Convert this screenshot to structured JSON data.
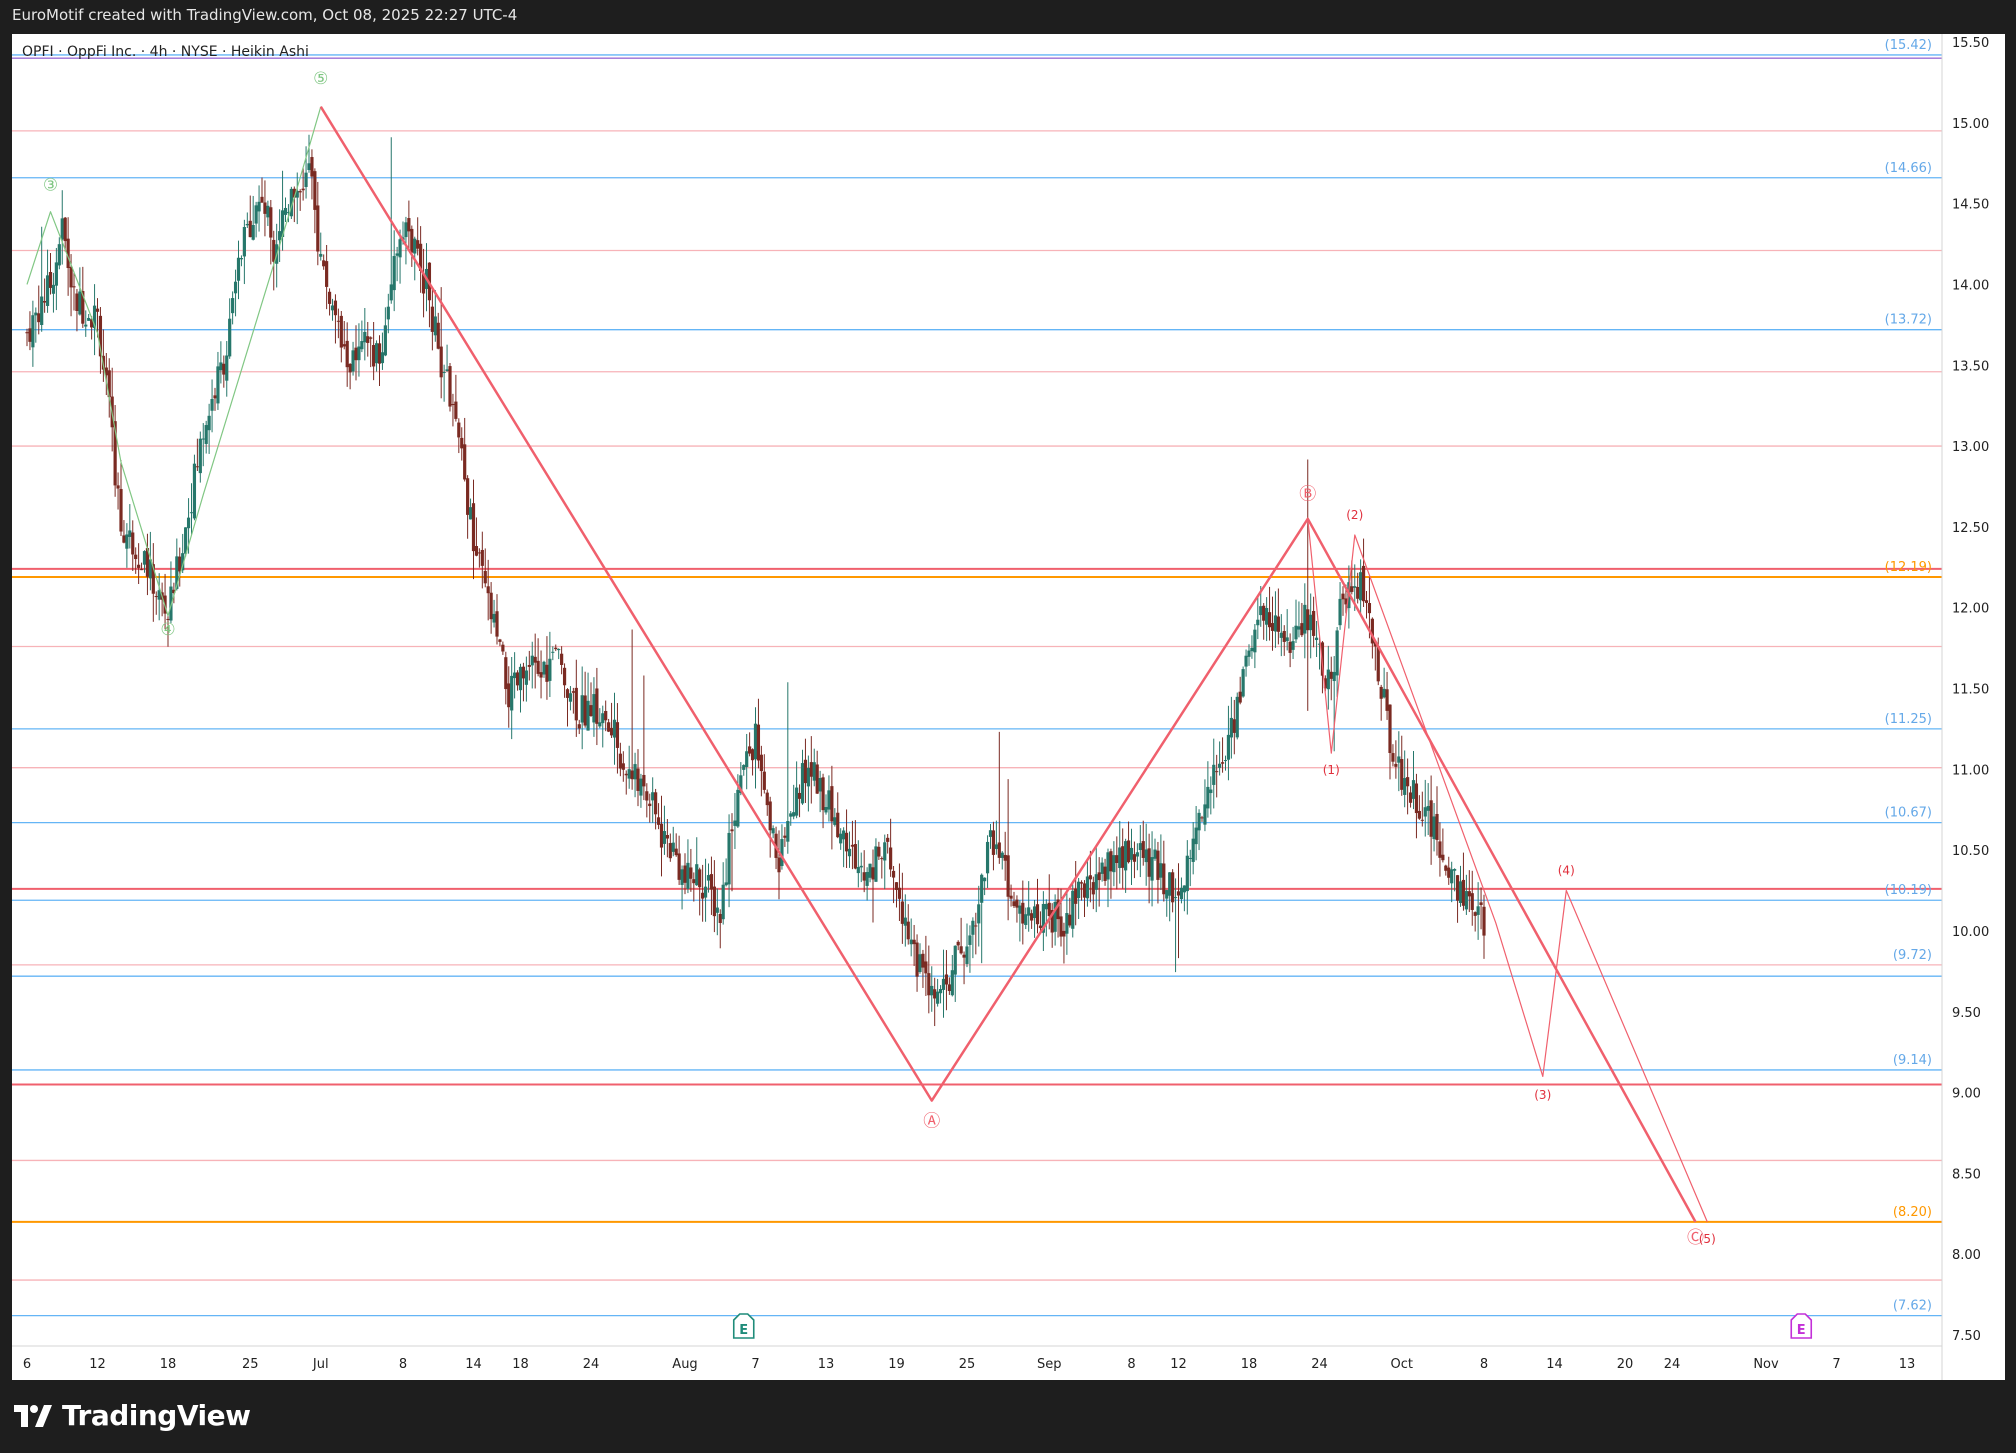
{
  "header": {
    "caption": "EuroMotif created with TradingView.com, Oct 08, 2025 22:27 UTC-4"
  },
  "legend": {
    "symbol_line": "OPFI · OppFi Inc. · 4h · NYSE · Heikin Ashi"
  },
  "brand": {
    "name": "TradingView",
    "icon": "tradingview-logo-icon"
  },
  "colors": {
    "bull": "#26776b",
    "bear": "#7a2a22",
    "wave_red": "#f0606d",
    "wave_green": "#81c784",
    "level_blue": "#64b5f6",
    "level_pink": "#f7b3b8",
    "level_orange": "#ff9800",
    "label_blue": "#64a8e8",
    "label_orange": "#ff9800",
    "earnings": "#1f8c7a",
    "earnings_future": "#c330d8"
  },
  "chart_data": {
    "type": "candlestick",
    "title": "OPFI · OppFi Inc. · 4h · NYSE · Heikin Ashi",
    "y_axis": {
      "min": 7.5,
      "max": 15.5,
      "ticks": [
        "15.50",
        "15.00",
        "14.50",
        "14.00",
        "13.50",
        "13.00",
        "12.50",
        "12.00",
        "11.50",
        "11.00",
        "10.50",
        "10.00",
        "9.50",
        "9.00",
        "8.50",
        "8.00",
        "7.50"
      ]
    },
    "x_axis": {
      "start": "2025-06-06",
      "end": "2025-11-13",
      "ticks": [
        {
          "date": "2025-06-06",
          "label": "6"
        },
        {
          "date": "2025-06-12",
          "label": "12"
        },
        {
          "date": "2025-06-18",
          "label": "18"
        },
        {
          "date": "2025-06-25",
          "label": "25"
        },
        {
          "date": "2025-07-01",
          "label": "Jul"
        },
        {
          "date": "2025-07-08",
          "label": "8"
        },
        {
          "date": "2025-07-14",
          "label": "14"
        },
        {
          "date": "2025-07-18",
          "label": "18"
        },
        {
          "date": "2025-07-24",
          "label": "24"
        },
        {
          "date": "2025-08-01",
          "label": "Aug"
        },
        {
          "date": "2025-08-07",
          "label": "7"
        },
        {
          "date": "2025-08-13",
          "label": "13"
        },
        {
          "date": "2025-08-19",
          "label": "19"
        },
        {
          "date": "2025-08-25",
          "label": "25"
        },
        {
          "date": "2025-09-01",
          "label": "Sep"
        },
        {
          "date": "2025-09-08",
          "label": "8"
        },
        {
          "date": "2025-09-12",
          "label": "12"
        },
        {
          "date": "2025-09-18",
          "label": "18"
        },
        {
          "date": "2025-09-24",
          "label": "24"
        },
        {
          "date": "2025-10-01",
          "label": "Oct"
        },
        {
          "date": "2025-10-08",
          "label": "8"
        },
        {
          "date": "2025-10-14",
          "label": "14"
        },
        {
          "date": "2025-10-20",
          "label": "20"
        },
        {
          "date": "2025-10-24",
          "label": "24"
        },
        {
          "date": "2025-11-01",
          "label": "Nov"
        },
        {
          "date": "2025-11-07",
          "label": "7"
        },
        {
          "date": "2025-11-13",
          "label": "13"
        }
      ]
    },
    "price_path": [
      [
        "2025-06-06",
        13.7
      ],
      [
        "2025-06-08",
        14.0
      ],
      [
        "2025-06-09",
        14.35
      ],
      [
        "2025-06-10",
        13.9
      ],
      [
        "2025-06-12",
        13.8
      ],
      [
        "2025-06-13",
        13.2
      ],
      [
        "2025-06-14",
        12.5
      ],
      [
        "2025-06-16",
        12.3
      ],
      [
        "2025-06-17",
        12.1
      ],
      [
        "2025-06-18",
        11.95
      ],
      [
        "2025-06-19",
        12.3
      ],
      [
        "2025-06-20",
        12.7
      ],
      [
        "2025-06-21",
        13.1
      ],
      [
        "2025-06-23",
        13.6
      ],
      [
        "2025-06-24",
        14.1
      ],
      [
        "2025-06-25",
        14.4
      ],
      [
        "2025-06-26",
        14.55
      ],
      [
        "2025-06-27",
        14.25
      ],
      [
        "2025-06-28",
        14.5
      ],
      [
        "2025-06-30",
        14.7
      ],
      [
        "2025-07-01",
        14.15
      ],
      [
        "2025-07-02",
        13.85
      ],
      [
        "2025-07-03",
        13.55
      ],
      [
        "2025-07-04",
        13.5
      ],
      [
        "2025-07-05",
        13.65
      ],
      [
        "2025-07-06",
        13.5
      ],
      [
        "2025-07-07",
        14.05
      ],
      [
        "2025-07-08",
        14.4
      ],
      [
        "2025-07-09",
        14.2
      ],
      [
        "2025-07-10",
        14.0
      ],
      [
        "2025-07-11",
        13.6
      ],
      [
        "2025-07-12",
        13.3
      ],
      [
        "2025-07-13",
        12.9
      ],
      [
        "2025-07-14",
        12.4
      ],
      [
        "2025-07-15",
        12.1
      ],
      [
        "2025-07-16",
        11.8
      ],
      [
        "2025-07-17",
        11.45
      ],
      [
        "2025-07-18",
        11.55
      ],
      [
        "2025-07-19",
        11.6
      ],
      [
        "2025-07-20",
        11.6
      ],
      [
        "2025-07-21",
        11.7
      ],
      [
        "2025-07-22",
        11.55
      ],
      [
        "2025-07-23",
        11.35
      ],
      [
        "2025-07-24",
        11.4
      ],
      [
        "2025-07-25",
        11.3
      ],
      [
        "2025-07-26",
        11.2
      ],
      [
        "2025-07-27",
        11.0
      ],
      [
        "2025-07-28",
        10.9
      ],
      [
        "2025-07-29",
        10.8
      ],
      [
        "2025-07-30",
        10.6
      ],
      [
        "2025-07-31",
        10.5
      ],
      [
        "2025-08-01",
        10.3
      ],
      [
        "2025-08-02",
        10.35
      ],
      [
        "2025-08-03",
        10.25
      ],
      [
        "2025-08-04",
        10.1
      ],
      [
        "2025-08-05",
        10.7
      ],
      [
        "2025-08-06",
        11.0
      ],
      [
        "2025-08-07",
        11.2
      ],
      [
        "2025-08-08",
        10.7
      ],
      [
        "2025-08-09",
        10.45
      ],
      [
        "2025-08-10",
        10.7
      ],
      [
        "2025-08-11",
        10.95
      ],
      [
        "2025-08-12",
        11.0
      ],
      [
        "2025-08-13",
        10.8
      ],
      [
        "2025-08-14",
        10.65
      ],
      [
        "2025-08-15",
        10.5
      ],
      [
        "2025-08-16",
        10.35
      ],
      [
        "2025-08-17",
        10.4
      ],
      [
        "2025-08-18",
        10.5
      ],
      [
        "2025-08-19",
        10.3
      ],
      [
        "2025-08-20",
        10.0
      ],
      [
        "2025-08-21",
        9.75
      ],
      [
        "2025-08-22",
        9.6
      ],
      [
        "2025-08-23",
        9.6
      ],
      [
        "2025-08-24",
        9.8
      ],
      [
        "2025-08-25",
        9.9
      ],
      [
        "2025-08-26",
        10.2
      ],
      [
        "2025-08-27",
        10.6
      ],
      [
        "2025-08-28",
        10.4
      ],
      [
        "2025-08-29",
        10.1
      ],
      [
        "2025-08-30",
        10.15
      ],
      [
        "2025-08-31",
        10.05
      ],
      [
        "2025-09-01",
        10.1
      ],
      [
        "2025-09-02",
        10.05
      ],
      [
        "2025-09-03",
        10.15
      ],
      [
        "2025-09-04",
        10.25
      ],
      [
        "2025-09-05",
        10.35
      ],
      [
        "2025-09-06",
        10.4
      ],
      [
        "2025-09-07",
        10.45
      ],
      [
        "2025-09-08",
        10.5
      ],
      [
        "2025-09-09",
        10.45
      ],
      [
        "2025-09-10",
        10.4
      ],
      [
        "2025-09-11",
        10.3
      ],
      [
        "2025-09-12",
        10.25
      ],
      [
        "2025-09-13",
        10.45
      ],
      [
        "2025-09-14",
        10.8
      ],
      [
        "2025-09-15",
        10.95
      ],
      [
        "2025-09-16",
        11.1
      ],
      [
        "2025-09-17",
        11.4
      ],
      [
        "2025-09-18",
        11.75
      ],
      [
        "2025-09-19",
        11.95
      ],
      [
        "2025-09-20",
        11.95
      ],
      [
        "2025-09-21",
        11.75
      ],
      [
        "2025-09-22",
        11.8
      ],
      [
        "2025-09-23",
        11.95
      ],
      [
        "2025-09-24",
        11.7
      ],
      [
        "2025-09-25",
        11.5
      ],
      [
        "2025-09-26",
        12.1
      ],
      [
        "2025-09-27",
        12.2
      ],
      [
        "2025-09-28",
        12.05
      ],
      [
        "2025-09-29",
        11.6
      ],
      [
        "2025-09-30",
        11.2
      ],
      [
        "2025-10-01",
        10.95
      ],
      [
        "2025-10-02",
        10.85
      ],
      [
        "2025-10-03",
        10.75
      ],
      [
        "2025-10-04",
        10.55
      ],
      [
        "2025-10-05",
        10.4
      ],
      [
        "2025-10-06",
        10.25
      ],
      [
        "2025-10-07",
        10.1
      ],
      [
        "2025-10-08",
        10.05
      ]
    ],
    "levels": [
      {
        "value": 15.42,
        "color": "#64b5f6",
        "label": "(15.42)",
        "label_color": "#64a8e8"
      },
      {
        "value": 15.4,
        "color": "#9c6fd6"
      },
      {
        "value": 14.95,
        "color": "#f7b3b8"
      },
      {
        "value": 14.66,
        "color": "#64b5f6",
        "label": "(14.66)",
        "label_color": "#64a8e8"
      },
      {
        "value": 14.21,
        "color": "#f7b3b8"
      },
      {
        "value": 13.72,
        "color": "#64b5f6",
        "label": "(13.72)",
        "label_color": "#64a8e8"
      },
      {
        "value": 13.46,
        "color": "#f7b3b8"
      },
      {
        "value": 13.0,
        "color": "#f7b3b8"
      },
      {
        "value": 12.24,
        "color": "#f0606d"
      },
      {
        "value": 12.19,
        "color": "#ff9800",
        "label": "(12.19)",
        "label_color": "#ff9800"
      },
      {
        "value": 11.76,
        "color": "#f7b3b8"
      },
      {
        "value": 11.25,
        "color": "#64b5f6",
        "label": "(11.25)",
        "label_color": "#64a8e8"
      },
      {
        "value": 11.01,
        "color": "#f7b3b8"
      },
      {
        "value": 10.67,
        "color": "#64b5f6",
        "label": "(10.67)",
        "label_color": "#64a8e8"
      },
      {
        "value": 10.26,
        "color": "#f0606d"
      },
      {
        "value": 10.19,
        "color": "#64b5f6",
        "label": "(10.19)",
        "label_color": "#64a8e8"
      },
      {
        "value": 9.79,
        "color": "#f7b3b8",
        "label": "(9.72)",
        "label_color": "#64a8e8"
      },
      {
        "value": 9.72,
        "color": "#64b5f6"
      },
      {
        "value": 9.14,
        "color": "#64b5f6",
        "label": "(9.14)",
        "label_color": "#64a8e8"
      },
      {
        "value": 9.05,
        "color": "#f0606d"
      },
      {
        "value": 8.58,
        "color": "#f7b3b8"
      },
      {
        "value": 8.2,
        "color": "#ff9800",
        "label": "(8.20)",
        "label_color": "#ff9800"
      },
      {
        "value": 7.84,
        "color": "#f7b3b8"
      },
      {
        "value": 7.62,
        "color": "#64b5f6",
        "label": "(7.62)",
        "label_color": "#64a8e8"
      }
    ],
    "waves": [
      {
        "name": "green-impulse",
        "color": "#81c784",
        "width": 1.2,
        "points": [
          [
            "2025-06-06",
            14.0
          ],
          [
            "2025-06-08",
            14.45
          ],
          [
            "2025-06-12",
            13.7
          ],
          [
            "2025-06-14",
            12.9
          ],
          [
            "2025-06-18",
            11.95
          ],
          [
            "2025-06-21",
            12.7
          ],
          [
            "2025-06-29",
            14.6
          ],
          [
            "2025-07-01",
            15.1
          ]
        ]
      },
      {
        "name": "abc-correction",
        "color": "#f0606d",
        "width": 2.5,
        "points": [
          [
            "2025-07-01",
            15.1
          ],
          [
            "2025-08-22",
            8.95
          ],
          [
            "2025-09-23",
            12.55
          ],
          [
            "2025-10-26",
            8.2
          ]
        ]
      },
      {
        "name": "impulse-5",
        "color": "#f0606d",
        "width": 1.2,
        "points": [
          [
            "2025-09-23",
            12.55
          ],
          [
            "2025-09-25",
            11.1
          ],
          [
            "2025-09-27",
            12.45
          ],
          [
            "2025-10-09",
            10.05
          ],
          [
            "2025-10-13",
            9.1
          ],
          [
            "2025-10-15",
            10.25
          ],
          [
            "2025-10-27",
            8.2
          ]
        ]
      }
    ],
    "wave_labels": [
      {
        "text": "③",
        "date": "2025-06-08",
        "value": 14.58,
        "color": "#81c784"
      },
      {
        "text": "④",
        "date": "2025-06-18",
        "value": 11.83,
        "color": "#81c784"
      },
      {
        "text": "⑤",
        "date": "2025-07-01",
        "value": 15.24,
        "color": "#81c784"
      },
      {
        "text": "Ⓐ",
        "date": "2025-08-22",
        "value": 8.79,
        "color": "#f0606d"
      },
      {
        "text": "Ⓑ",
        "date": "2025-09-23",
        "value": 12.67,
        "color": "#f0606d"
      },
      {
        "text": "Ⓒ",
        "date": "2025-10-26",
        "value": 8.07,
        "color": "#f0606d"
      },
      {
        "text": "(1)",
        "date": "2025-09-25",
        "value": 10.97,
        "color": "#e0303d"
      },
      {
        "text": "(2)",
        "date": "2025-09-27",
        "value": 12.55,
        "color": "#e0303d"
      },
      {
        "text": "(3)",
        "date": "2025-10-13",
        "value": 8.96,
        "color": "#e0303d"
      },
      {
        "text": "(4)",
        "date": "2025-10-15",
        "value": 10.35,
        "color": "#e0303d"
      },
      {
        "text": "(5)",
        "date": "2025-10-27",
        "value": 8.07,
        "color": "#e0303d"
      }
    ],
    "earnings_markers": [
      {
        "date": "2025-08-06",
        "label": "E",
        "color": "#1f8c7a",
        "upcoming": false
      },
      {
        "date": "2025-11-04",
        "label": "E",
        "color": "#c330d8",
        "upcoming": true
      }
    ]
  }
}
